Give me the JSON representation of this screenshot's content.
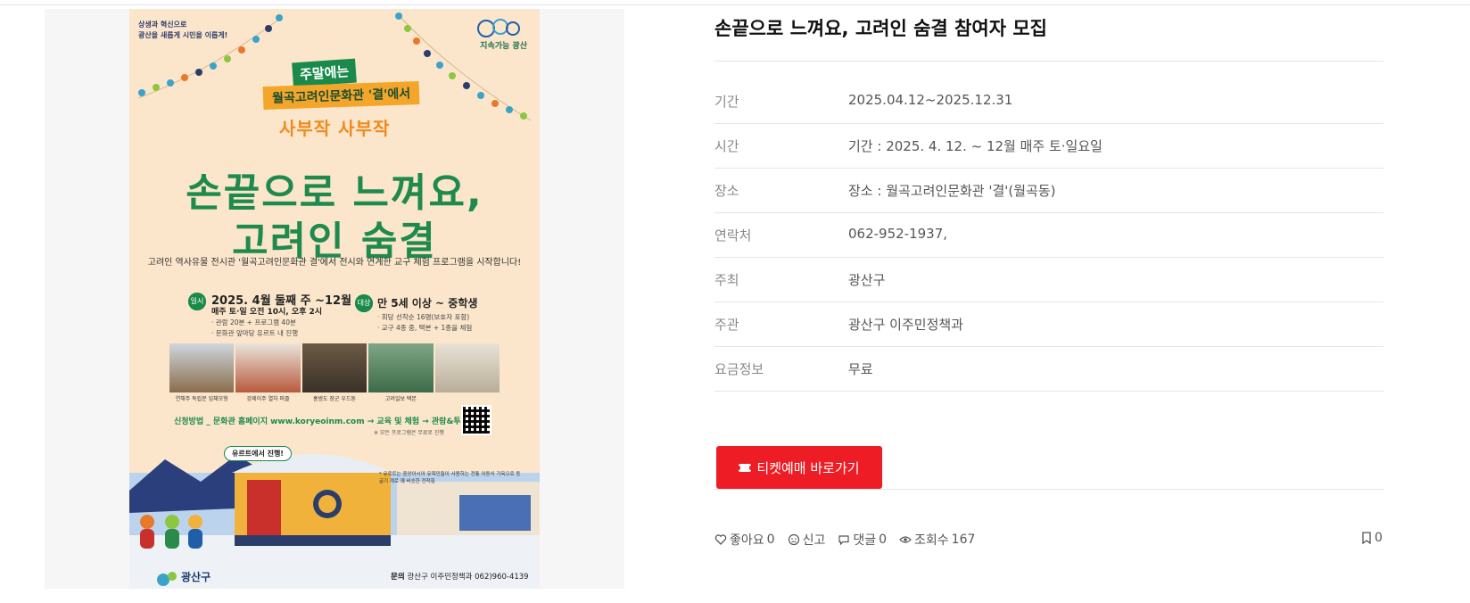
{
  "event": {
    "title": "손끝으로 느껴요, 고려인 숨결 참여자 모집",
    "rows": [
      {
        "label": "기간",
        "value": "2025.04.12~2025.12.31"
      },
      {
        "label": "시간",
        "value": "기간 : 2025. 4. 12. ~ 12월 매주 토·일요일"
      },
      {
        "label": "장소",
        "value": "장소 : 월곡고려인문화관 '결'(월곡동)"
      },
      {
        "label": "연락처",
        "value": "062-952-1937,"
      },
      {
        "label": "주최",
        "value": "광산구"
      },
      {
        "label": "주관",
        "value": "광산구 이주민정책과"
      },
      {
        "label": "요금정보",
        "value": "무료"
      }
    ],
    "ticket_button": "티켓예매 바로가기",
    "stats": {
      "like_label": "좋아요",
      "like_count": "0",
      "report_label": "신고",
      "comment_label": "댓글",
      "comment_count": "0",
      "view_label": "조회수",
      "view_count": "167",
      "bookmark_count": "0"
    },
    "icons": [
      "heart-icon",
      "report-icon",
      "comment-icon",
      "eye-icon",
      "bookmark-icon",
      "ticket-icon"
    ]
  },
  "poster": {
    "tagline_1": "상생과 혁신으로",
    "tagline_2": "광산을 새롭게 시민을 이롭게!",
    "logo_text": "지속가능 광산",
    "weekend": "주말에는",
    "venue": "월곡고려인문화관 '결'에서",
    "sabu": "사부작 사부작",
    "title_1": "손끝으로 느껴요,",
    "title_2": "고려인 숨결",
    "intro": "고려인 역사유물 전시관 '월곡고려인문화관 결'에서 전시와 연계한 교구 체험 프로그램을 시작합니다!",
    "when_badge": "일시",
    "when": "2025. 4월 둘째 주 ~12월",
    "when_sub": "매주 토·일 오전 10시, 오후 2시",
    "when_note_1": "· 관람 20분 + 프로그램 40분",
    "when_note_2": "· 문화관 앞마당 유르트 내 진행",
    "who_badge": "대상",
    "who": "만 5세 이상 ~ 중학생",
    "who_note_1": "· 회당 선착순 16명(보호자 포함)",
    "who_note_2": "· 교구 4종 중, 택본 + 1종을 체험",
    "captions": [
      "연해주 독립문 입체모형",
      "강제이주 열차 퍼즐",
      "홍범도 장군 우드톤",
      "고려일보 택본",
      ""
    ],
    "apply": "신청방법 _ 문화관 홈페이지 www.koryeoinm.com → 교육 및 체험 → 관람&투어 예약",
    "apply_note": "※ 모든 프로그램은 무료로 진행",
    "bubble": "유르트에서 진행!",
    "small_note": "* 유르트는 중앙아시아 유목민들이 사용하는 전통 이동식 가옥으로 둥글기 계로 꽤 비슷한 전착힘",
    "gu_logo": "광산구",
    "contact_label": "문의",
    "contact": "광산구 이주민정책과 062)960-4139",
    "colors": {
      "bg": "#fbe6cc",
      "green": "#1a8a4a",
      "orange": "#f4a62a",
      "ticket_red": "#ee1d25"
    }
  }
}
